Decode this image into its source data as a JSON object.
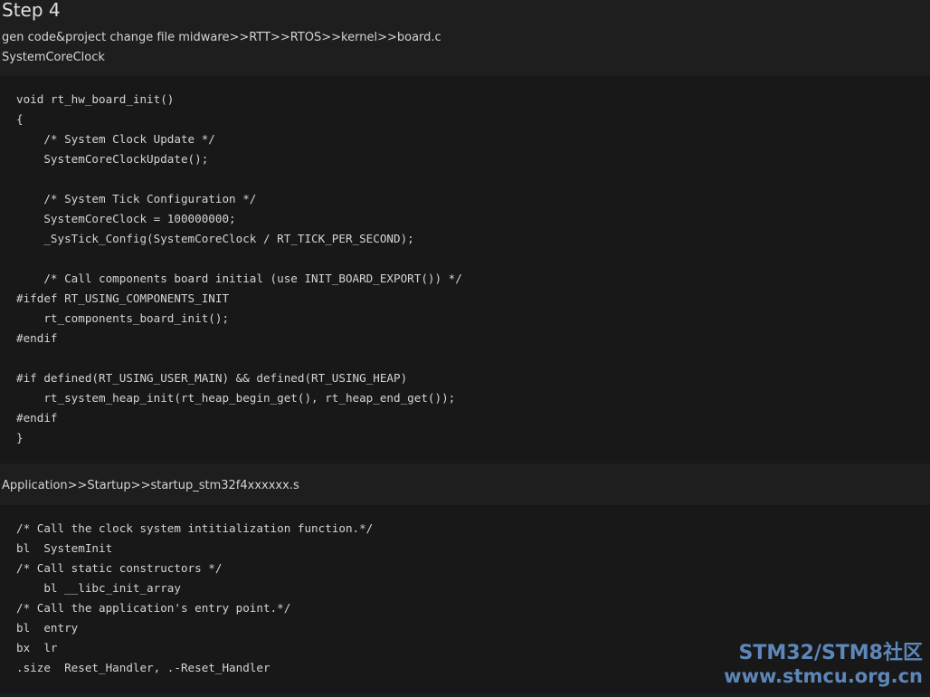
{
  "heading": "Step 4",
  "path_line": "gen code&project change file midware>>RTT>>RTOS>>kernel>>board.c",
  "function_name": "SystemCoreClock",
  "code_block_1": [
    "void rt_hw_board_init()",
    "{",
    "    /* System Clock Update */",
    "    SystemCoreClockUpdate();",
    "",
    "    /* System Tick Configuration */",
    "    SystemCoreClock = 100000000;",
    "    _SysTick_Config(SystemCoreClock / RT_TICK_PER_SECOND);",
    "",
    "    /* Call components board initial (use INIT_BOARD_EXPORT()) */",
    "#ifdef RT_USING_COMPONENTS_INIT",
    "    rt_components_board_init();",
    "#endif",
    "",
    "#if defined(RT_USING_USER_MAIN) && defined(RT_USING_HEAP)",
    "    rt_system_heap_init(rt_heap_begin_get(), rt_heap_end_get());",
    "#endif",
    "}"
  ],
  "startup_path": "Application>>Startup>>startup_stm32f4xxxxxx.s",
  "code_block_2": [
    "/* Call the clock system intitialization function.*/",
    "bl  SystemInit",
    "/* Call static constructors */",
    "    bl __libc_init_array",
    "/* Call the application's entry point.*/",
    "bl  entry",
    "bx  lr",
    ".size  Reset_Handler, .-Reset_Handler"
  ],
  "watermark": {
    "line1": "STM32/STM8社区",
    "line2": "www.stmcu.org.cn"
  }
}
